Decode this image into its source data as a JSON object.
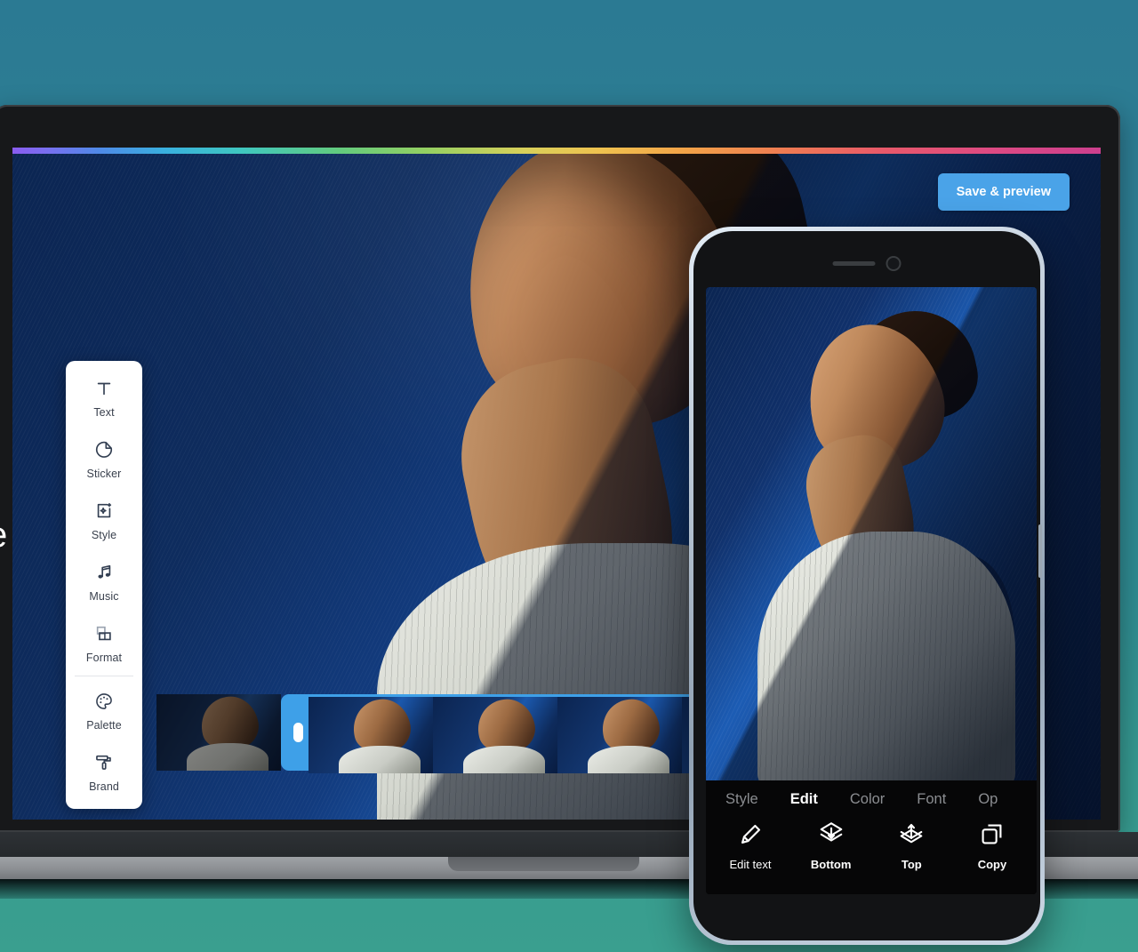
{
  "theme": {
    "background_color": "#2b7a93",
    "accent_blue": "#3ea0e8",
    "save_button_color": "#4aa3e8",
    "sidebar_bg": "#ffffff",
    "sidebar_text": "#39404d",
    "phone_toolbar_bg": "#060607",
    "canvas_bg": "#0d2650"
  },
  "edge_caption": "e",
  "editor": {
    "save_button_label": "Save & preview",
    "sidebar": {
      "group_one": [
        {
          "label": "Text",
          "icon": "text-icon"
        },
        {
          "label": "Sticker",
          "icon": "sticker-icon"
        },
        {
          "label": "Style",
          "icon": "style-icon"
        },
        {
          "label": "Music",
          "icon": "music-icon"
        },
        {
          "label": "Format",
          "icon": "format-icon"
        }
      ],
      "group_two": [
        {
          "label": "Palette",
          "icon": "palette-icon"
        },
        {
          "label": "Brand",
          "icon": "brand-icon"
        }
      ]
    },
    "timeline": {
      "clips": [
        {
          "selected": false
        },
        {
          "selected": true
        },
        {
          "selected": true
        },
        {
          "selected": true
        },
        {
          "selected": true
        }
      ],
      "selected_start_index": 1,
      "handle": "trim-handle"
    }
  },
  "phone": {
    "status": {
      "speaker": "speaker-grille",
      "camera": "front-camera"
    },
    "toolbar": {
      "tabs": [
        {
          "label": "Style",
          "active": false
        },
        {
          "label": "Edit",
          "active": true
        },
        {
          "label": "Color",
          "active": false
        },
        {
          "label": "Font",
          "active": false
        },
        {
          "label": "Op",
          "active": false,
          "truncated": true
        }
      ],
      "actions": [
        {
          "label": "Edit text",
          "icon": "pencil-icon",
          "bold": false
        },
        {
          "label": "Bottom",
          "icon": "send-to-back-icon",
          "bold": true
        },
        {
          "label": "Top",
          "icon": "bring-to-front-icon",
          "bold": true
        },
        {
          "label": "Copy",
          "icon": "duplicate-icon",
          "bold": true
        }
      ]
    }
  }
}
